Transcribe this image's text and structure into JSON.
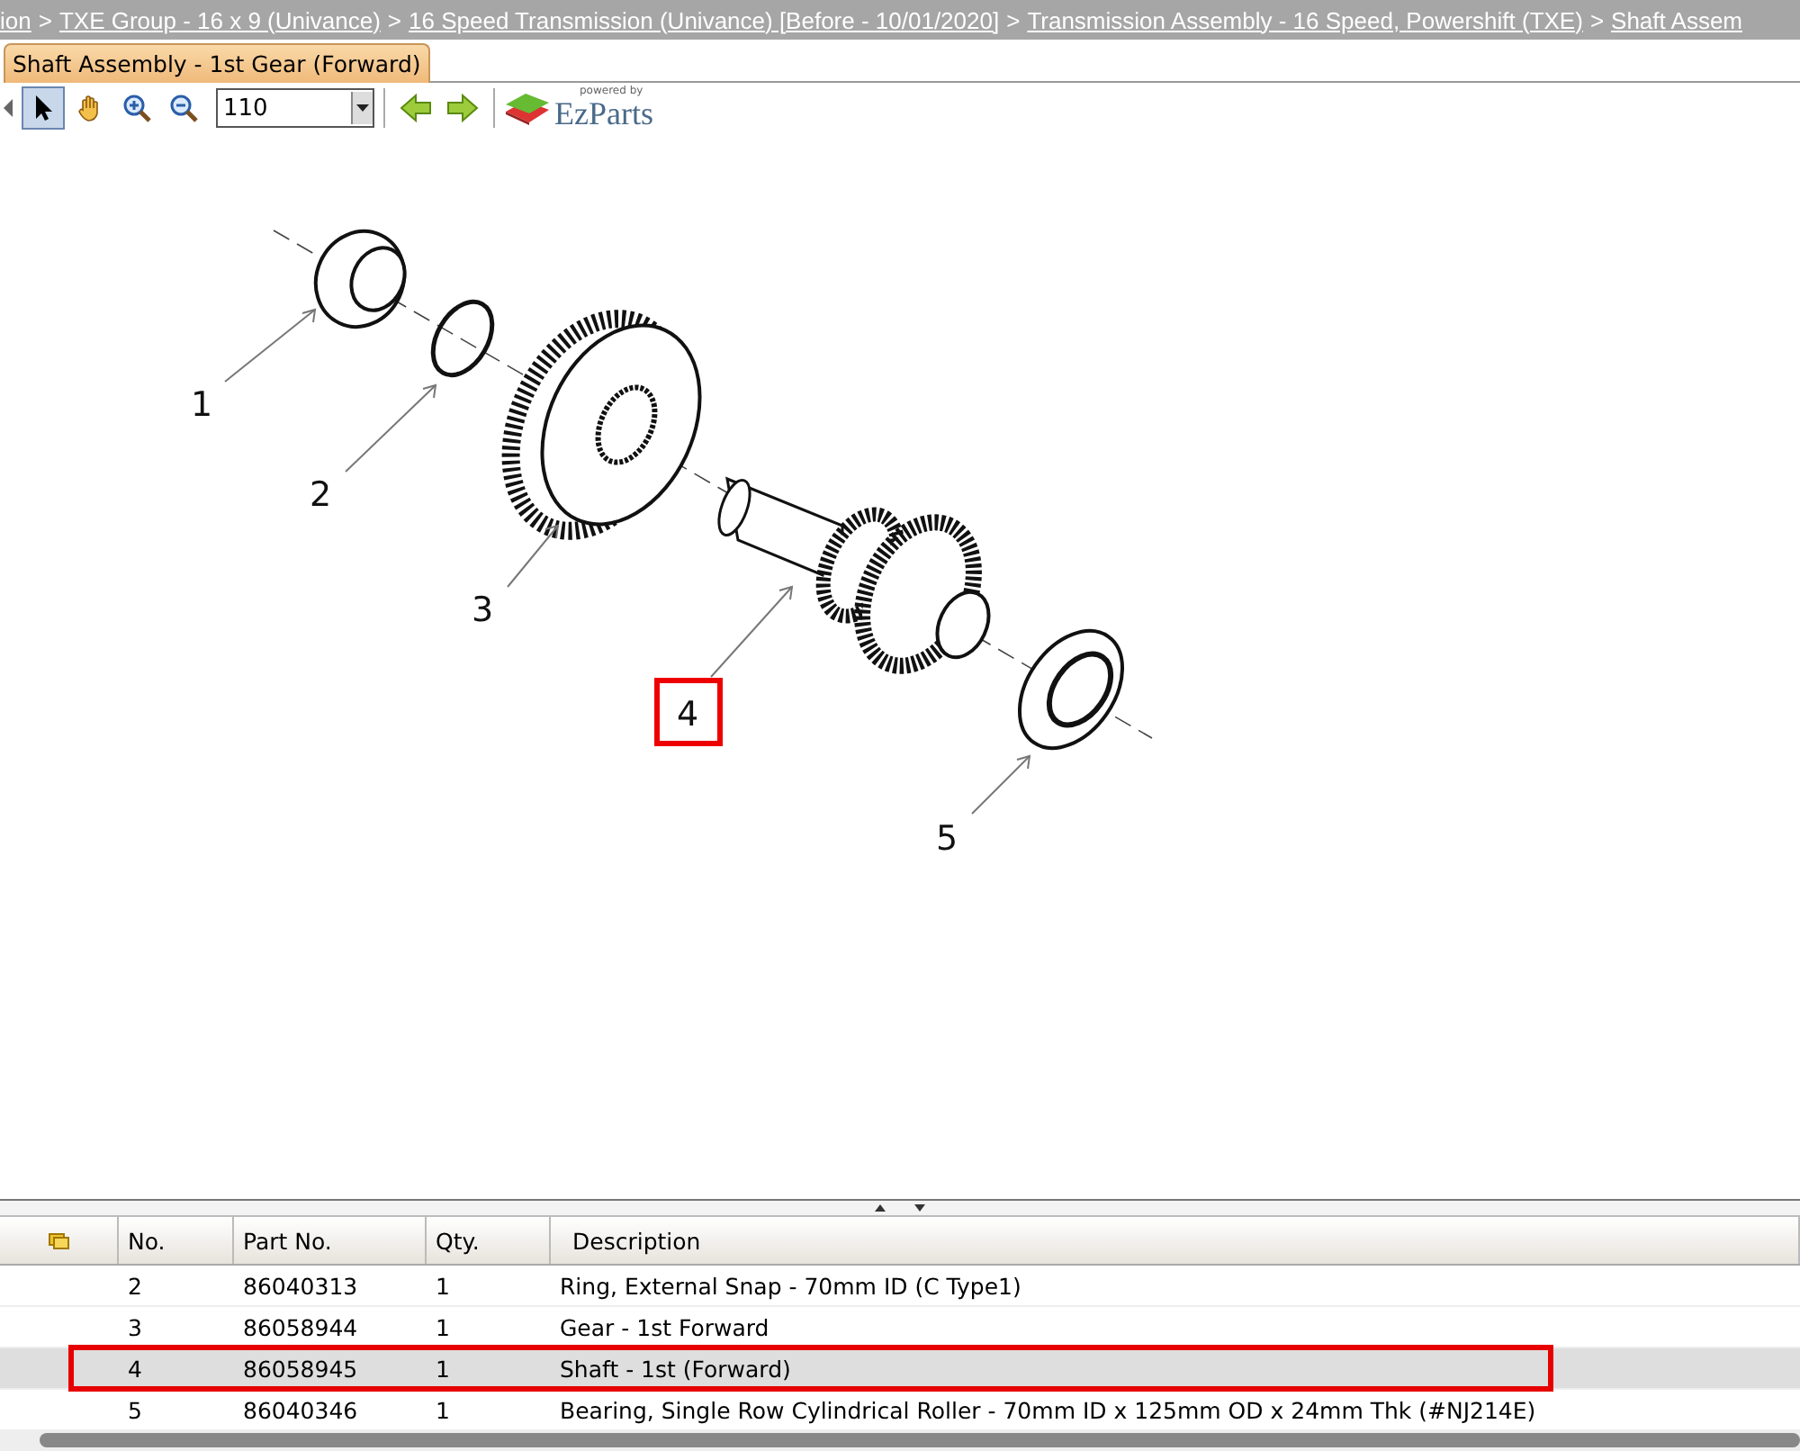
{
  "breadcrumb": [
    {
      "label": "ion"
    },
    {
      "label": "TXE Group - 16 x 9 (Univance)"
    },
    {
      "label": "16 Speed Transmission (Univance) [Before - 10/01/2020]"
    },
    {
      "label": "Transmission Assembly - 16 Speed, Powershift (TXE)"
    },
    {
      "label": "Shaft Assem"
    }
  ],
  "breadcrumb_separator": ">",
  "tabs": [
    {
      "label": "Shaft Assembly - 1st Gear (Forward)",
      "selected": true
    }
  ],
  "toolbar": {
    "tools": [
      {
        "kind": "pointer",
        "selected": true
      },
      {
        "kind": "hand",
        "selected": false
      },
      {
        "kind": "zoom-in",
        "selected": false
      },
      {
        "kind": "zoom-out",
        "selected": false
      }
    ],
    "zoom_value": "110",
    "logo": {
      "tagline": "powered by",
      "name": "EzParts"
    }
  },
  "callouts": [
    {
      "label": "1",
      "selected": false
    },
    {
      "label": "2",
      "selected": false
    },
    {
      "label": "3",
      "selected": false
    },
    {
      "label": "4",
      "selected": true
    },
    {
      "label": "5",
      "selected": false
    }
  ],
  "table": {
    "columns": [
      "No.",
      "Part No.",
      "Qty.",
      "Description"
    ],
    "rows": [
      {
        "no": "2",
        "part_no": "86040313",
        "qty": "1",
        "description": "Ring, External Snap - 70mm ID (C Type1)",
        "selected": false
      },
      {
        "no": "3",
        "part_no": "86058944",
        "qty": "1",
        "description": "Gear - 1st Forward",
        "selected": false
      },
      {
        "no": "4",
        "part_no": "86058945",
        "qty": "1",
        "description": "Shaft - 1st (Forward)",
        "selected": true
      },
      {
        "no": "5",
        "part_no": "86040346",
        "qty": "1",
        "description": "Bearing, Single Row Cylindrical Roller - 70mm ID x 125mm OD x 24mm Thk (#NJ214E)",
        "selected": false
      }
    ]
  }
}
